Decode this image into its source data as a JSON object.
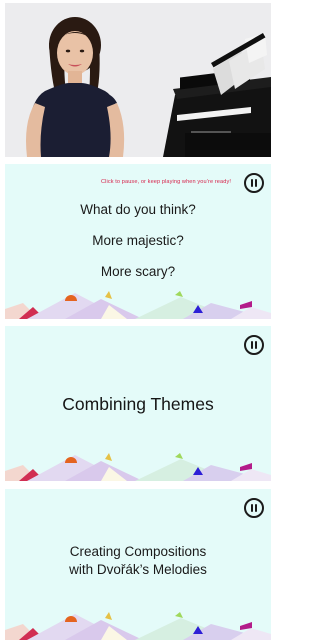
{
  "video": {
    "scene": "presenter-at-piano"
  },
  "frames": [
    {
      "hint": "Click to pause, or keep playing when you’re ready!",
      "lines": [
        "What do you think?",
        "More majestic?",
        "More scary?"
      ],
      "control": "pause-icon"
    },
    {
      "title": "Combining Themes",
      "control": "pause-icon"
    },
    {
      "title_line_1": "Creating Compositions",
      "title_line_2": "with Dvořák’s Melodies",
      "control": "pause-icon"
    }
  ],
  "colors": {
    "slide_background": "#e4fbf9",
    "hint_text": "#d6234b",
    "heading_text": "#1a1a1a"
  }
}
